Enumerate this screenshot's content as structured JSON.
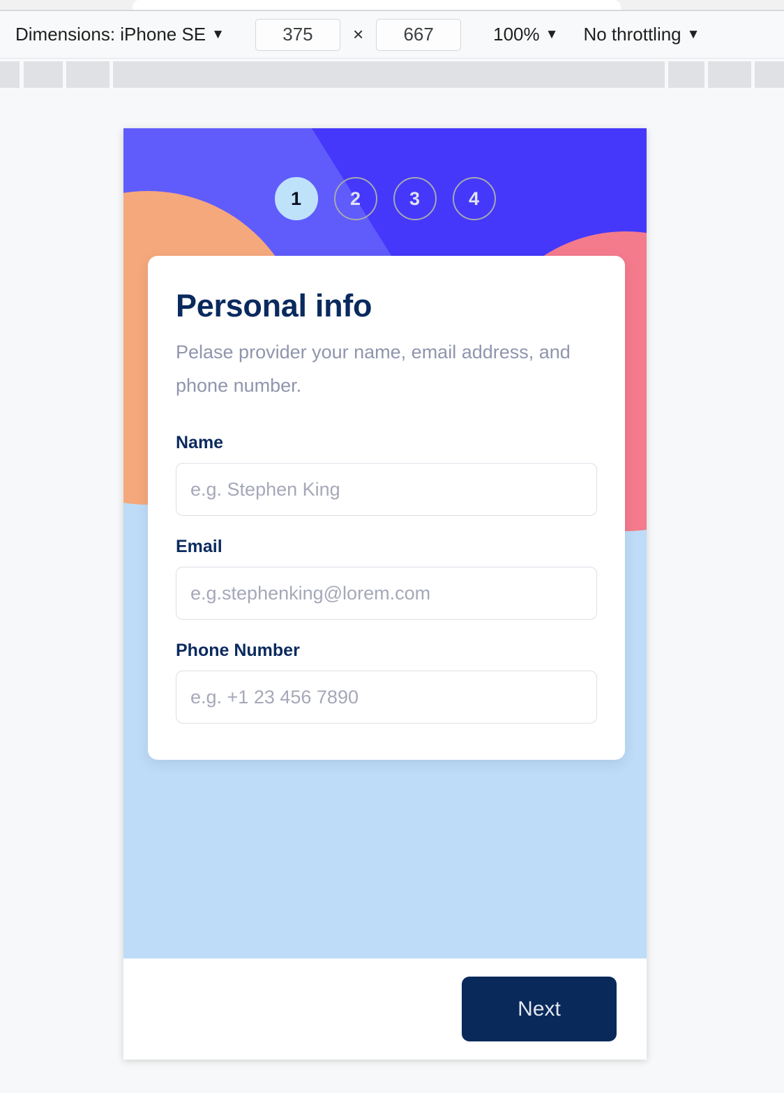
{
  "devtools": {
    "dimensions_label": "Dimensions: iPhone SE",
    "width_value": "375",
    "height_value": "667",
    "multiply_symbol": "×",
    "zoom_label": "100%",
    "throttling_label": "No throttling",
    "caret": "▼"
  },
  "app": {
    "steps": [
      {
        "number": "1",
        "active": true
      },
      {
        "number": "2",
        "active": false
      },
      {
        "number": "3",
        "active": false
      },
      {
        "number": "4",
        "active": false
      }
    ],
    "form": {
      "title": "Personal info",
      "subtitle": "Pelase provider your name, email address, and phone number.",
      "fields": [
        {
          "label": "Name",
          "value": "",
          "placeholder": "e.g. Stephen King"
        },
        {
          "label": "Email",
          "value": "",
          "placeholder": "e.g.stephenking@lorem.com"
        },
        {
          "label": "Phone Number",
          "value": "",
          "placeholder": "e.g. +1 23 456 7890"
        }
      ]
    },
    "footer": {
      "next_label": "Next"
    },
    "colors": {
      "header_blue_dark": "#4538fb",
      "header_blue_light": "#605cfb",
      "blob_orange": "#f5a87b",
      "blob_pink": "#f47b8c",
      "page_light_blue": "#bedcf7",
      "accent_navy": "#0a2a5e",
      "step_active_fill": "#bfe2fb"
    }
  }
}
